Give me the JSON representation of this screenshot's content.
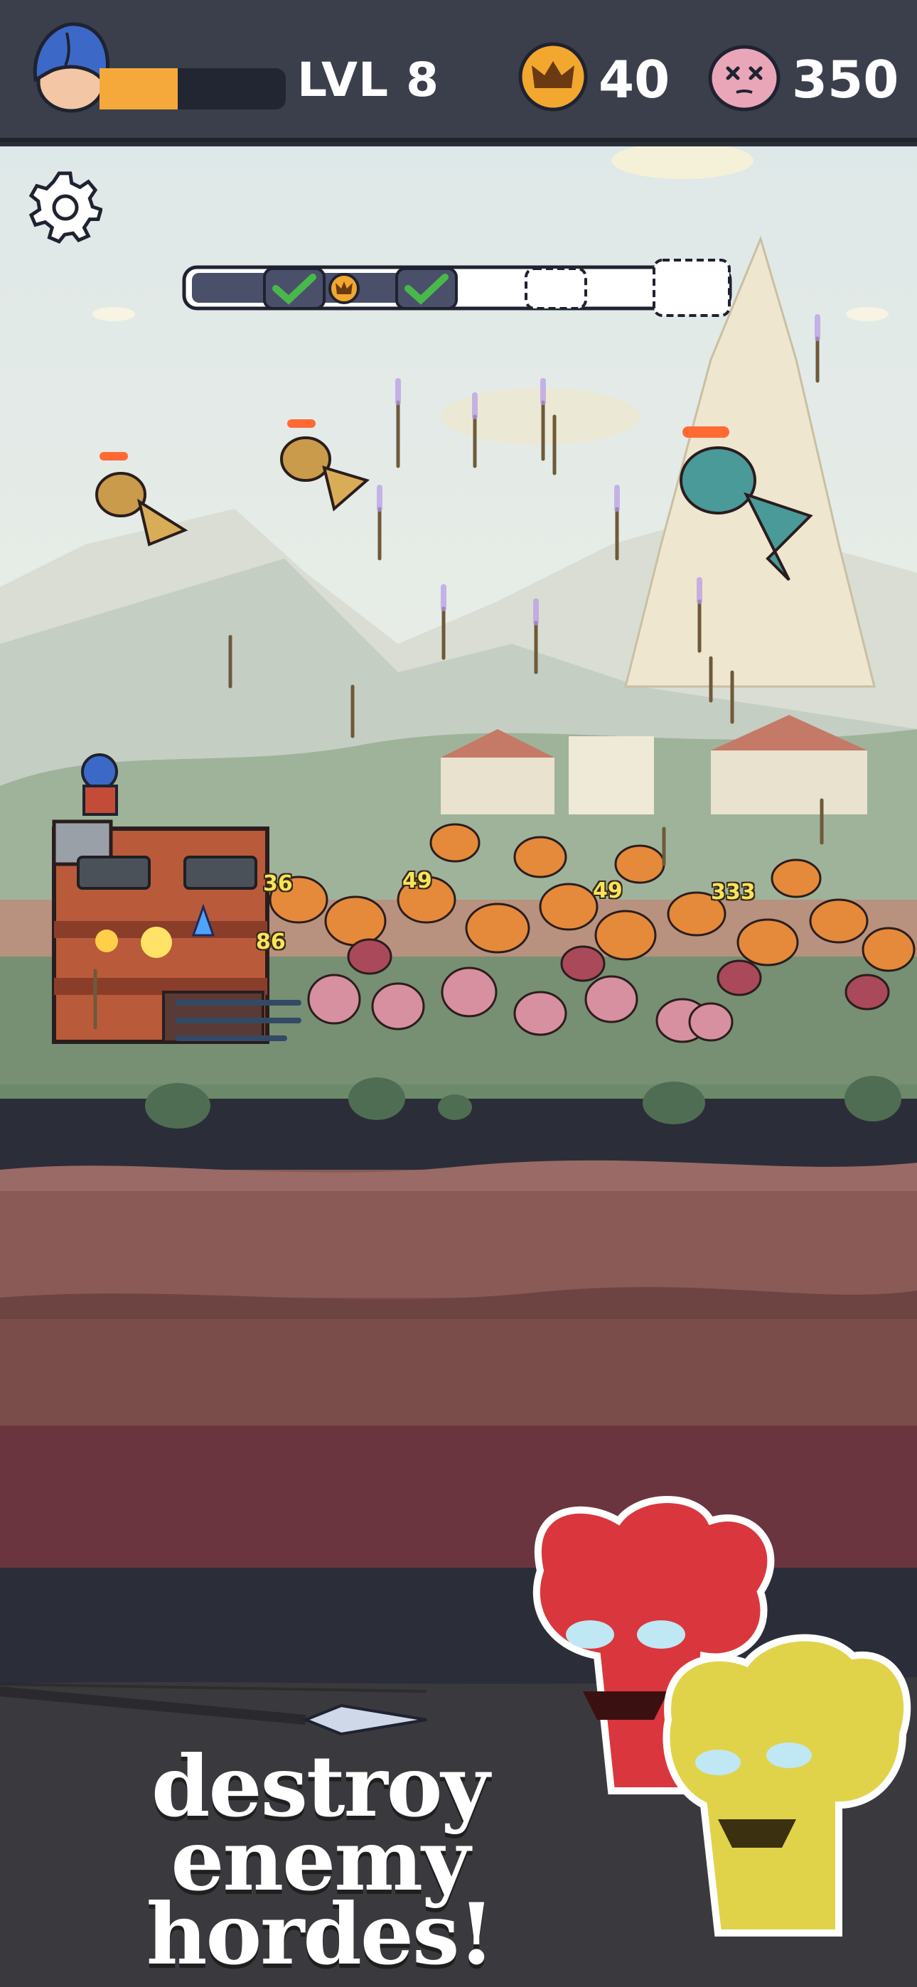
{
  "hud": {
    "level_label": "LVL 8",
    "xp_progress": 0.42,
    "crowns": "40",
    "kills": "350",
    "icons": {
      "avatar": "hero-hooded-avatar-icon",
      "crown": "crown-icon",
      "kills": "skull-kill-icon"
    }
  },
  "wave": {
    "stages": 5,
    "completed": 2,
    "icons": [
      "sword-check-icon",
      "crown-icon"
    ]
  },
  "damage_numbers": [
    "36",
    "49",
    "49",
    "333",
    "86"
  ],
  "promo": {
    "line1": "destroy",
    "line2": "enemy hordes!"
  },
  "colors": {
    "hud_bg": "#3b3f4c",
    "xp_fill": "#f5a93b",
    "crown_gold": "#f2a72f",
    "kill_pink": "#e9a6b8",
    "sky": "#e4ecec",
    "grass": "#6c8a6a",
    "dirt": "#7a4d4b",
    "promo_bg": "#6b3540"
  }
}
